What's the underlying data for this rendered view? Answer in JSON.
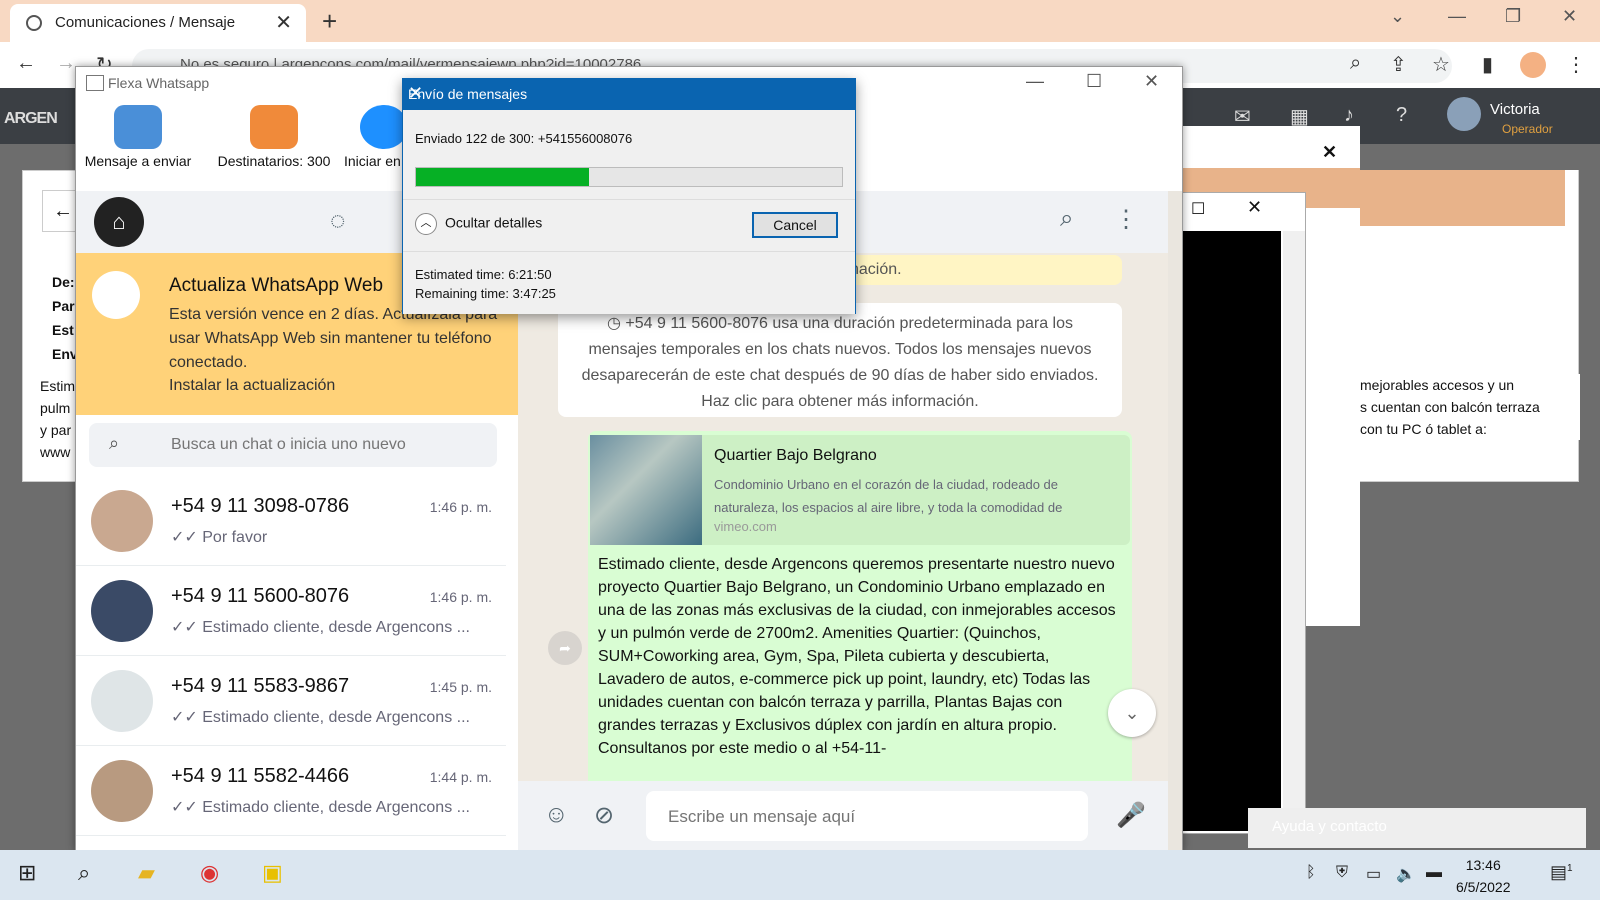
{
  "browser": {
    "tab_title": "Comunicaciones / Mensaje",
    "url": "No es seguro  |  argencons.com/mail/vermensajewp.php?id=10002786"
  },
  "site": {
    "logo": "ARGEN",
    "user": "Victoria",
    "role": "Operador",
    "labels": [
      "De:",
      "Par",
      "Est",
      "Env"
    ],
    "body_left": [
      "Estim",
      "pulm",
      "y par",
      "www"
    ],
    "body_right": [
      "mejorables accesos y un",
      "s cuentan con balcón terraza",
      "con tu PC ó tablet a:"
    ],
    "help": "Ayuda y contacto"
  },
  "flexa": {
    "title": "Flexa Whatsapp",
    "tools": [
      "Mensaje a enviar",
      "Destinatarios: 300",
      "Iniciar en"
    ]
  },
  "banner": {
    "title": "Actualiza WhatsApp Web",
    "text": "Esta versión vence en 2 días. Actualízala para usar WhatsApp Web sin mantener tu teléfono conectado.",
    "link": "Instalar la actualización"
  },
  "search": {
    "placeholder": "Busca un chat o inicia uno nuevo"
  },
  "chats": [
    {
      "name": "+54 9 11 3098-0786",
      "time": "1:46 p. m.",
      "preview": "✓✓ Por favor",
      "color": "#c9a890"
    },
    {
      "name": "+54 9 11 5600-8076",
      "time": "1:46 p. m.",
      "preview": "✓✓ Estimado cliente, desde Argencons ...",
      "color": "#3a4a66"
    },
    {
      "name": "+54 9 11 5583-9867",
      "time": "1:45 p. m.",
      "preview": "✓✓ Estimado cliente, desde Argencons ...",
      "color": "#dfe5e7"
    },
    {
      "name": "+54 9 11 5582-4466",
      "time": "1:44 p. m.",
      "preview": "✓✓ Estimado cliente, desde Argencons ...",
      "color": "#b89a80"
    }
  ],
  "conversation": {
    "sys1": "nformación.",
    "sys2": "◷ +54 9 11 5600-8076 usa una duración predeterminada para los mensajes temporales en los chats nuevos. Todos los mensajes nuevos desaparecerán de este chat después de 90 días de haber sido enviados. Haz clic para obtener más información.",
    "preview_title": "Quartier Bajo Belgrano",
    "preview_desc": "Condominio Urbano en el corazón de la ciudad, rodeado de naturaleza, los espacios al aire libre, y toda la comodidad de",
    "preview_url": "vimeo.com",
    "message": "Estimado cliente, desde Argencons queremos presentarte nuestro nuevo proyecto Quartier Bajo Belgrano, un Condominio Urbano emplazado en una de las zonas más exclusivas de la ciudad, con inmejorables accesos y un pulmón verde de 2700m2. Amenities Quartier: (Quinchos, SUM+Coworking area, Gym, Spa, Pileta cubierta y descubierta, Lavadero de autos, e-commerce pick up point, laundry, etc)  Todas las unidades cuentan con balcón terraza y parrilla, Plantas Bajas con grandes terrazas y Exclusivos dúplex con jardín en altura propio. Consultanos por este medio o al +54-11-",
    "composer_placeholder": "Escribe un mensaje aquí"
  },
  "progress": {
    "title": "Envío de mensajes",
    "status": "Enviado 122 de 300: +541556008076",
    "sent": 122,
    "total": 300,
    "toggle": "Ocultar detalles",
    "cancel": "Cancel",
    "estimated": "Estimated time: 6:21:50",
    "remaining": "Remaining time: 3:47:25"
  },
  "taskbar": {
    "time": "13:46",
    "date": "6/5/2022",
    "notif": "1"
  }
}
